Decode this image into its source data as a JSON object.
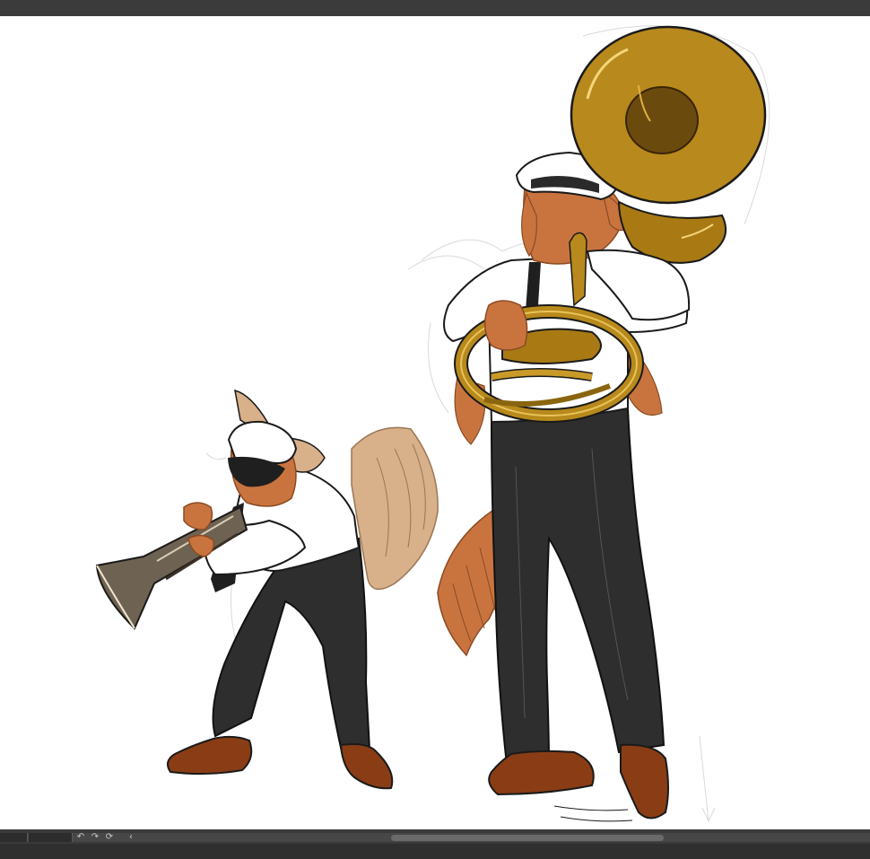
{
  "app": {
    "accent_dark": "#3b3b3b",
    "canvas_bg": "#ffffff"
  },
  "toolbar_bottom": {
    "icons": [
      "undo-icon",
      "redo-icon",
      "rotate-reset-icon",
      "chevron-left-icon"
    ],
    "glyphs": {
      "undo": "↶",
      "redo": "↷",
      "rotate": "⟳",
      "chevron": "‹"
    }
  },
  "artwork": {
    "subjects": [
      "trumpet-player",
      "sousaphone-player"
    ],
    "colors": {
      "fur_orange": "#c9743f",
      "fur_tan": "#d8b08a",
      "pants": "#2e2e2e",
      "shoes": "#8a3d15",
      "brass_gold": "#b8891c",
      "brass_dark": "#6b4a0e",
      "trumpet_metal": "#6e6252",
      "shirt": "#ffffff",
      "line": "#1a1a1a"
    }
  }
}
